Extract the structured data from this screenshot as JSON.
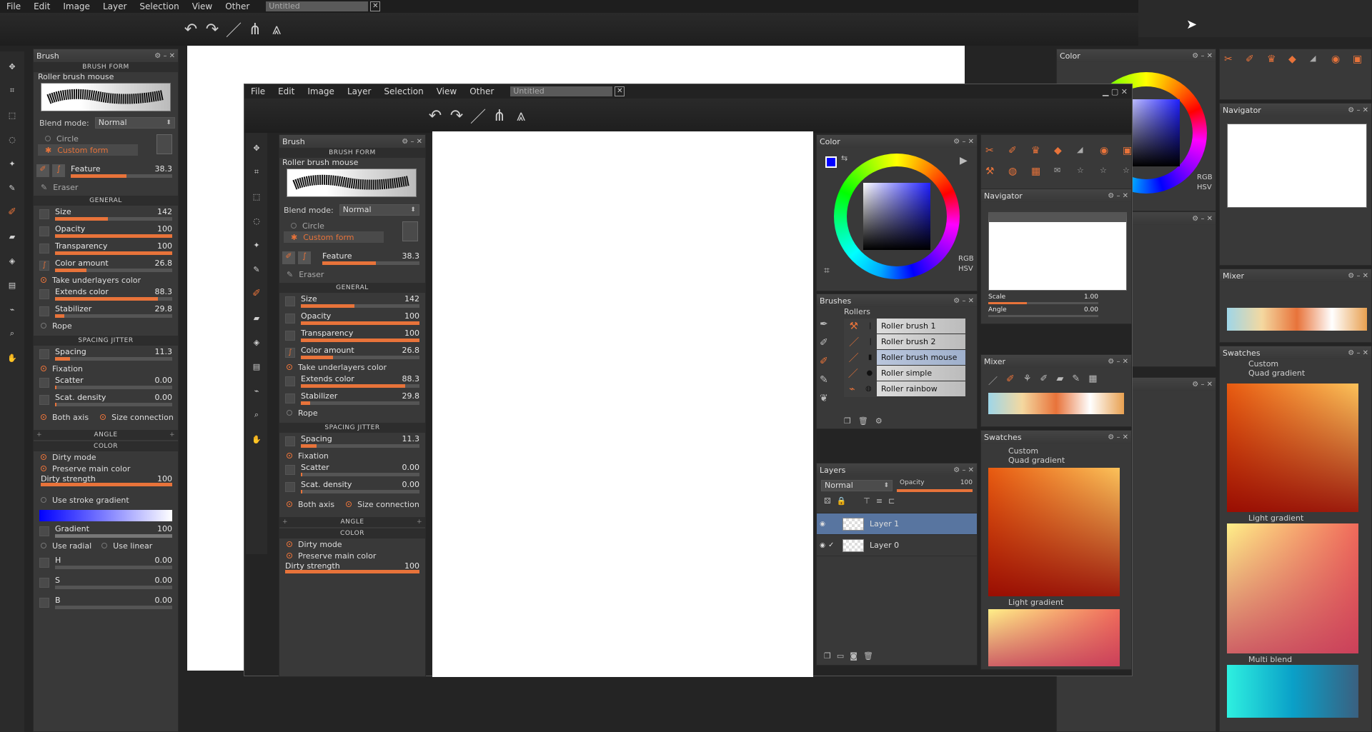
{
  "menu": [
    "File",
    "Edit",
    "Image",
    "Layer",
    "Selection",
    "View",
    "Other"
  ],
  "doc_title": "Untitled",
  "brush": {
    "title": "Brush",
    "form_header": "BRUSH FORM",
    "form_name": "Roller brush mouse",
    "blend_label": "Blend mode:",
    "blend_value": "Normal",
    "circle": "Circle",
    "custom_form": "Custom form",
    "feature": {
      "label": "Feature",
      "value": "38.3",
      "pct": 0.55
    },
    "eraser": "Eraser",
    "general_header": "GENERAL",
    "general": [
      {
        "label": "Size",
        "value": "142",
        "pct": 0.45
      },
      {
        "label": "Opacity",
        "value": "100",
        "pct": 1.0
      },
      {
        "label": "Transparency",
        "value": "100",
        "pct": 1.0
      },
      {
        "label": "Color amount",
        "value": "26.8",
        "pct": 0.27
      }
    ],
    "take_underlayers": "Take underlayers color",
    "general2": [
      {
        "label": "Extends color",
        "value": "88.3",
        "pct": 0.88
      },
      {
        "label": "Stabilizer",
        "value": "29.8",
        "pct": 0.08
      }
    ],
    "rope": "Rope",
    "jitter_header": "SPACING JITTER",
    "spacing": {
      "label": "Spacing",
      "value": "11.3",
      "pct": 0.13
    },
    "fixation": "Fixation",
    "scatter": {
      "label": "Scatter",
      "value": "0.00",
      "pct": 0.0
    },
    "scat_density": {
      "label": "Scat. density",
      "value": "0.00",
      "pct": 0.0
    },
    "both_axis": "Both axis",
    "size_connection": "Size connection",
    "angle_header": "ANGLE",
    "color_header": "COLOR",
    "dirty_mode": "Dirty mode",
    "preserve": "Preserve main color",
    "dirty_strength": {
      "label": "Dirty strength",
      "value": "100",
      "pct": 1.0
    },
    "use_stroke_gradient": "Use stroke gradient",
    "gradient": {
      "label": "Gradient",
      "value": "100",
      "pct": 1.0
    },
    "use_radial": "Use radial",
    "use_linear": "Use linear",
    "h": {
      "label": "H",
      "value": "0.00"
    },
    "s": {
      "label": "S",
      "value": "0.00"
    },
    "b": {
      "label": "B",
      "value": "0.00"
    }
  },
  "color": {
    "title": "Color",
    "rgb": "RGB",
    "hsv": "HSV"
  },
  "navigator": {
    "title": "Navigator",
    "scale_label": "Scale",
    "scale_value": "1.00",
    "scale_pct": 0.35,
    "angle_label": "Angle",
    "angle_value": "0.00"
  },
  "brushes": {
    "title": "Brushes",
    "group": "Rollers",
    "items": [
      "Roller brush 1",
      "Roller brush 2",
      "Roller brush mouse",
      "Roller simple",
      "Roller rainbow"
    ],
    "selected": 2
  },
  "mixer": {
    "title": "Mixer"
  },
  "swatches": {
    "title": "Swatches",
    "items": [
      "Custom",
      "Quad gradient",
      "Light gradient",
      "Multi blend"
    ]
  },
  "layers": {
    "title": "Layers",
    "blend": "Normal",
    "opacity_label": "Opacity",
    "opacity_value": "100",
    "items": [
      "Layer 1",
      "Layer 0"
    ],
    "selected": 0
  },
  "colors": {
    "accent": "#e8733a",
    "bg": "#242424",
    "panel": "#393939",
    "primary": "#0000ff",
    "selection": "#5875a0"
  }
}
